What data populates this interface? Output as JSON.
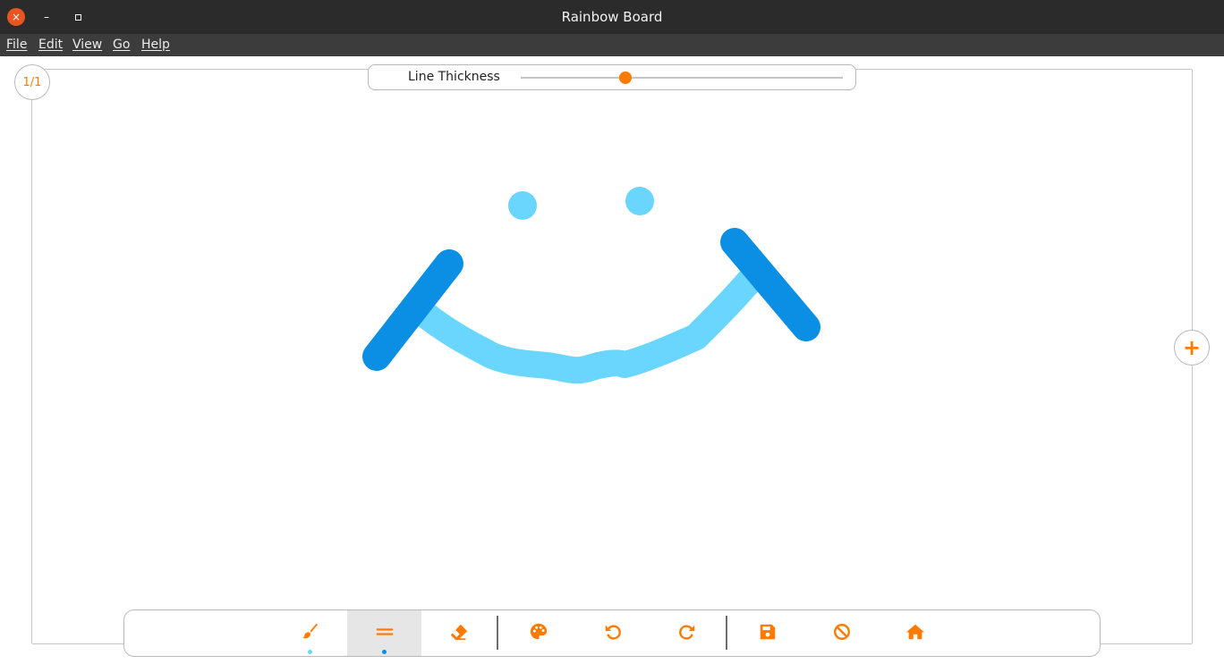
{
  "window": {
    "title": "Rainbow Board",
    "close_icon": "×",
    "minimize_icon": "–"
  },
  "menu": [
    {
      "label": "File"
    },
    {
      "label": "Edit"
    },
    {
      "label": "View"
    },
    {
      "label": "Go"
    },
    {
      "label": "Help"
    }
  ],
  "page_counter": "1/1",
  "thickness": {
    "label": "Line Thickness",
    "value_fraction": 0.325
  },
  "add_page_icon": "+",
  "colors": {
    "accent": "#ff7a00",
    "stroke_light": "#6ad6fe",
    "stroke_dark": "#0a8fe4",
    "titlebar": "#2b2b2b",
    "menubar": "#3c3c3c",
    "close_button": "#e95420"
  },
  "toolbar": {
    "tools": [
      {
        "name": "brush-icon",
        "active": false,
        "indicator": "#6ad6fe"
      },
      {
        "name": "line-icon",
        "active": true,
        "indicator": "#0a8fe4"
      },
      {
        "name": "eraser-icon",
        "active": false
      },
      {
        "name": "palette-icon",
        "active": false
      },
      {
        "name": "undo-icon",
        "active": false
      },
      {
        "name": "redo-icon",
        "active": false
      },
      {
        "name": "save-icon",
        "active": false
      },
      {
        "name": "clear-icon",
        "active": false
      },
      {
        "name": "home-icon",
        "active": false
      }
    ]
  }
}
